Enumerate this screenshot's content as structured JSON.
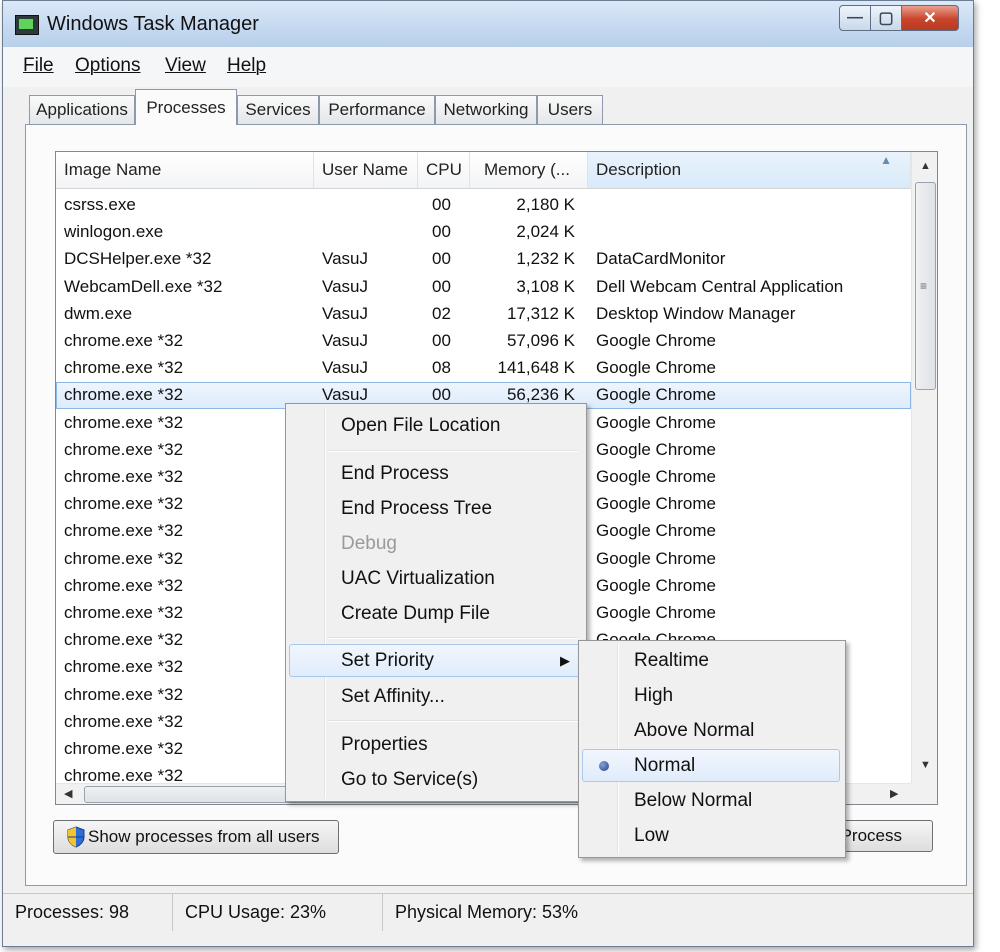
{
  "window": {
    "title": "Windows Task Manager",
    "icon": "task-manager-icon"
  },
  "caption_buttons": {
    "minimize": "—",
    "maximize": "▢",
    "close": "✕"
  },
  "menu": [
    "File",
    "Options",
    "View",
    "Help"
  ],
  "tabs": [
    "Applications",
    "Processes",
    "Services",
    "Performance",
    "Networking",
    "Users"
  ],
  "active_tab": "Processes",
  "columns": [
    "Image Name",
    "User Name",
    "CPU",
    "Memory (...",
    "Description"
  ],
  "sorted_column": "Description",
  "processes": [
    {
      "image": "csrss.exe",
      "user": "",
      "cpu": "00",
      "memory": "2,180 K",
      "desc": ""
    },
    {
      "image": "winlogon.exe",
      "user": "",
      "cpu": "00",
      "memory": "2,024 K",
      "desc": ""
    },
    {
      "image": "DCSHelper.exe *32",
      "user": "VasuJ",
      "cpu": "00",
      "memory": "1,232 K",
      "desc": "DataCardMonitor"
    },
    {
      "image": "WebcamDell.exe *32",
      "user": "VasuJ",
      "cpu": "00",
      "memory": "3,108 K",
      "desc": "Dell Webcam Central Application"
    },
    {
      "image": "dwm.exe",
      "user": "VasuJ",
      "cpu": "02",
      "memory": "17,312 K",
      "desc": "Desktop Window Manager"
    },
    {
      "image": "chrome.exe *32",
      "user": "VasuJ",
      "cpu": "00",
      "memory": "57,096 K",
      "desc": "Google Chrome"
    },
    {
      "image": "chrome.exe *32",
      "user": "VasuJ",
      "cpu": "08",
      "memory": "141,648 K",
      "desc": "Google Chrome"
    },
    {
      "image": "chrome.exe *32",
      "user": "VasuJ",
      "cpu": "00",
      "memory": "56,236 K",
      "desc": "Google Chrome"
    },
    {
      "image": "chrome.exe *32",
      "user": "",
      "cpu": "",
      "memory": "",
      "desc": "Google Chrome"
    },
    {
      "image": "chrome.exe *32",
      "user": "",
      "cpu": "",
      "memory": "",
      "desc": "Google Chrome"
    },
    {
      "image": "chrome.exe *32",
      "user": "",
      "cpu": "",
      "memory": "",
      "desc": "Google Chrome"
    },
    {
      "image": "chrome.exe *32",
      "user": "",
      "cpu": "",
      "memory": "",
      "desc": "Google Chrome"
    },
    {
      "image": "chrome.exe *32",
      "user": "",
      "cpu": "",
      "memory": "",
      "desc": "Google Chrome"
    },
    {
      "image": "chrome.exe *32",
      "user": "",
      "cpu": "",
      "memory": "",
      "desc": "Google Chrome"
    },
    {
      "image": "chrome.exe *32",
      "user": "",
      "cpu": "",
      "memory": "",
      "desc": "Google Chrome"
    },
    {
      "image": "chrome.exe *32",
      "user": "",
      "cpu": "",
      "memory": "",
      "desc": "Google Chrome"
    },
    {
      "image": "chrome.exe *32",
      "user": "",
      "cpu": "",
      "memory": "",
      "desc": "Google Chrome"
    },
    {
      "image": "chrome.exe *32",
      "user": "",
      "cpu": "",
      "memory": "",
      "desc": ""
    },
    {
      "image": "chrome.exe *32",
      "user": "",
      "cpu": "",
      "memory": "",
      "desc": ""
    },
    {
      "image": "chrome.exe *32",
      "user": "",
      "cpu": "",
      "memory": "",
      "desc": ""
    },
    {
      "image": "chrome.exe *32",
      "user": "",
      "cpu": "",
      "memory": "",
      "desc": ""
    },
    {
      "image": "chrome.exe *32",
      "user": "",
      "cpu": "",
      "memory": "",
      "desc": ""
    }
  ],
  "selected_row": 7,
  "buttons": {
    "show_all": "Show processes from all users",
    "end_process": "Process"
  },
  "status": {
    "processes": "Processes: 98",
    "cpu": "CPU Usage: 23%",
    "memory": "Physical Memory: 53%"
  },
  "context_menu": {
    "items": [
      {
        "label": "Open File Location"
      },
      {
        "label": "End Process"
      },
      {
        "label": "End Process Tree"
      },
      {
        "label": "Debug",
        "disabled": true
      },
      {
        "label": "UAC Virtualization"
      },
      {
        "label": "Create Dump File"
      },
      {
        "label": "Set Priority",
        "submenu": true,
        "highlighted": true
      },
      {
        "label": "Set Affinity..."
      },
      {
        "label": "Properties"
      },
      {
        "label": "Go to Service(s)"
      }
    ],
    "submenu_arrow": "▶"
  },
  "priority_menu": {
    "items": [
      "Realtime",
      "High",
      "Above Normal",
      "Normal",
      "Below Normal",
      "Low"
    ],
    "selected": "Normal"
  },
  "icons": {
    "shield": "uac-shield-icon",
    "sort": "sort-ascending-icon"
  },
  "colors": {
    "selection": "#dcebfb",
    "titlebar": "#c4d8ef",
    "close_button": "#c9442b"
  }
}
